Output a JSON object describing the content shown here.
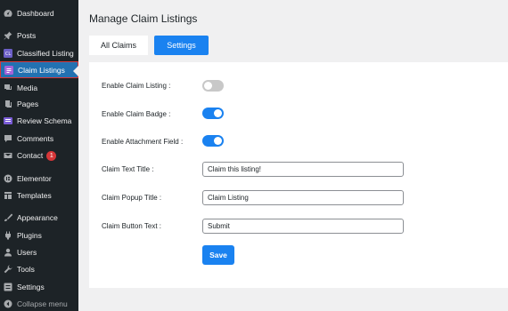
{
  "sidebar": {
    "items": [
      {
        "label": "Dashboard",
        "icon": "dashboard-icon"
      },
      {
        "label": "Posts",
        "icon": "pin-icon"
      },
      {
        "label": "Classified Listing",
        "icon": "classified-listing-icon"
      },
      {
        "label": "Claim Listings",
        "icon": "claim-listings-icon",
        "active": true
      },
      {
        "label": "Media",
        "icon": "media-icon"
      },
      {
        "label": "Pages",
        "icon": "pages-icon"
      },
      {
        "label": "Review Schema",
        "icon": "review-schema-icon"
      },
      {
        "label": "Comments",
        "icon": "comments-icon"
      },
      {
        "label": "Contact",
        "icon": "mail-icon",
        "badge": "1"
      },
      {
        "label": "Elementor",
        "icon": "elementor-icon"
      },
      {
        "label": "Templates",
        "icon": "templates-icon"
      },
      {
        "label": "Appearance",
        "icon": "brush-icon"
      },
      {
        "label": "Plugins",
        "icon": "plug-icon"
      },
      {
        "label": "Users",
        "icon": "user-icon"
      },
      {
        "label": "Tools",
        "icon": "wrench-icon"
      },
      {
        "label": "Settings",
        "icon": "settings-icon"
      },
      {
        "label": "Collapse menu",
        "icon": "collapse-icon"
      }
    ]
  },
  "page": {
    "title": "Manage Claim Listings",
    "tabs": {
      "all": "All Claims",
      "settings": "Settings"
    }
  },
  "settings": {
    "enable_claim_listing": {
      "label": "Enable Claim Listing :",
      "on": false
    },
    "enable_claim_badge": {
      "label": "Enable Claim Badge :",
      "on": true
    },
    "enable_attachment_field": {
      "label": "Enable Attachment Field :",
      "on": true
    },
    "claim_text_title": {
      "label": "Claim Text Title :",
      "value": "Claim this listing!"
    },
    "claim_popup_title": {
      "label": "Claim Popup Title :",
      "value": "Claim Listing"
    },
    "claim_button_text": {
      "label": "Claim Button Text :",
      "value": "Submit"
    },
    "save_label": "Save"
  },
  "colors": {
    "accent": "#1a82f0",
    "sidebar_bg": "#1d2327",
    "active_bg": "#2271b1",
    "badge": "#d63638"
  }
}
